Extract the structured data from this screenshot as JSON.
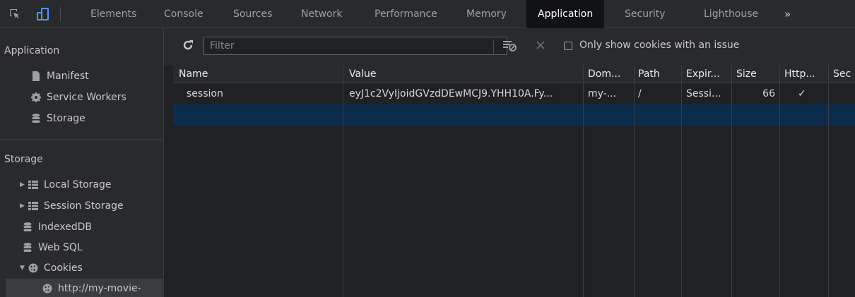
{
  "tabs": {
    "elements": "Elements",
    "console": "Console",
    "sources": "Sources",
    "network": "Network",
    "performance": "Performance",
    "memory": "Memory",
    "application": "Application",
    "security": "Security",
    "lighthouse": "Lighthouse",
    "more": "»"
  },
  "sidebar": {
    "application_heading": "Application",
    "app_items": [
      {
        "label": "Manifest",
        "icon": "file-icon"
      },
      {
        "label": "Service Workers",
        "icon": "gear-icon"
      },
      {
        "label": "Storage",
        "icon": "database-icon"
      }
    ],
    "storage_heading": "Storage",
    "storage_items": [
      {
        "label": "Local Storage",
        "icon": "grid-icon"
      },
      {
        "label": "Session Storage",
        "icon": "grid-icon"
      },
      {
        "label": "IndexedDB",
        "icon": "database-icon"
      },
      {
        "label": "Web SQL",
        "icon": "database-icon"
      },
      {
        "label": "Cookies",
        "icon": "cookie-icon"
      },
      {
        "label": "http://my-movie-",
        "icon": "cookie-icon"
      }
    ]
  },
  "toolbar": {
    "filter_placeholder": "Filter",
    "only_issue_label": "Only show cookies with an issue"
  },
  "table": {
    "headers": [
      "Name",
      "Value",
      "Dom...",
      "Path",
      "Expir...",
      "Size",
      "Http...",
      "Sec"
    ],
    "rows": [
      {
        "name": "session",
        "value": "eyJ1c2VyIjoidGVzdDEwMCJ9.YHH10A.Fy...",
        "domain": "my-...",
        "path": "/",
        "expires": "Sessi...",
        "size": "66",
        "httponly": "✓",
        "secure": ""
      }
    ]
  },
  "colors": {
    "background": "#202124",
    "panel": "#292a2d",
    "accent": "#1a73e8",
    "selected_row": "#0c2c4d"
  }
}
